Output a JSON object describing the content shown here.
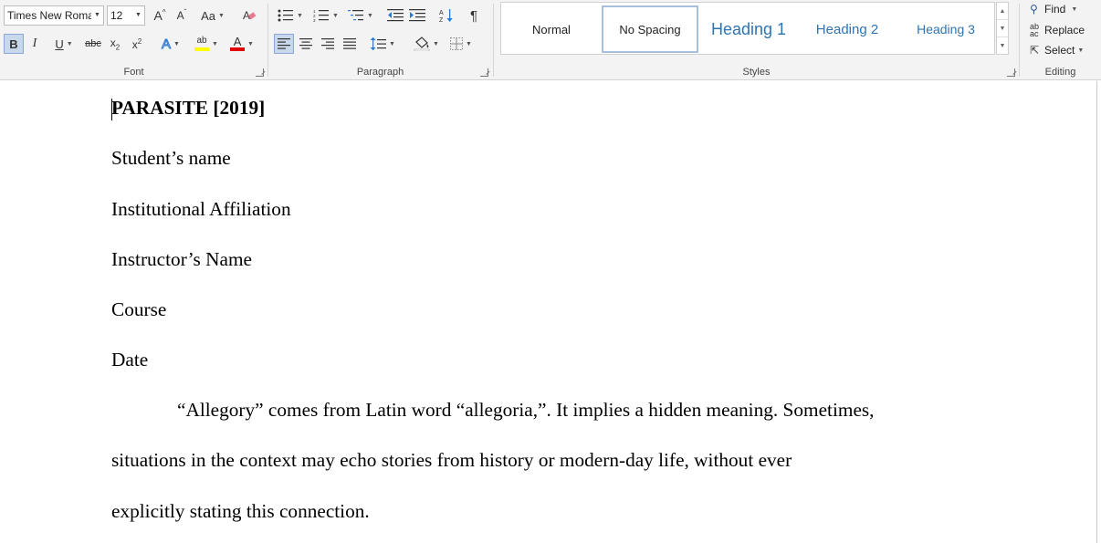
{
  "ribbon": {
    "font": {
      "group_label": "Font",
      "font_name": "Times New Roma",
      "font_size": "12",
      "grow_label": "A",
      "shrink_label": "A",
      "case_label": "Aa",
      "bold_label": "B",
      "italic_label": "I",
      "underline_label": "U",
      "strike_label": "abc",
      "subscript_label": "x",
      "superscript_label": "x",
      "sub_mark": "2",
      "sup_mark": "2",
      "effects_label": "A",
      "highlight_label": "ab",
      "color_label": "A",
      "highlight_color": "#ffff00",
      "font_color": "#e00000"
    },
    "paragraph": {
      "group_label": "Paragraph",
      "pilcrow_label": "¶"
    },
    "styles": {
      "group_label": "Styles",
      "items": [
        {
          "label": "Normal"
        },
        {
          "label": "No Spacing"
        },
        {
          "label": "Heading 1"
        },
        {
          "label": "Heading 2"
        },
        {
          "label": "Heading 3"
        }
      ],
      "heading_color": "#2e74b5"
    },
    "editing": {
      "group_label": "Editing",
      "find_label": "Find",
      "replace_label": "Replace",
      "select_label": "Select"
    }
  },
  "document": {
    "paragraphs": [
      {
        "text": "PARASITE [2019]",
        "bold": true
      },
      {
        "text": "Student’s name"
      },
      {
        "text": "Institutional Affiliation"
      },
      {
        "text": "Instructor’s Name"
      },
      {
        "text": "Course"
      },
      {
        "text": "Date"
      },
      {
        "text": "“Allegory” comes from Latin word “allegoria,”. It implies a hidden meaning. Sometimes,"
      },
      {
        "text": "situations in the context may echo stories from history or modern-day life, without ever"
      },
      {
        "text": "explicitly stating this connection."
      }
    ]
  }
}
